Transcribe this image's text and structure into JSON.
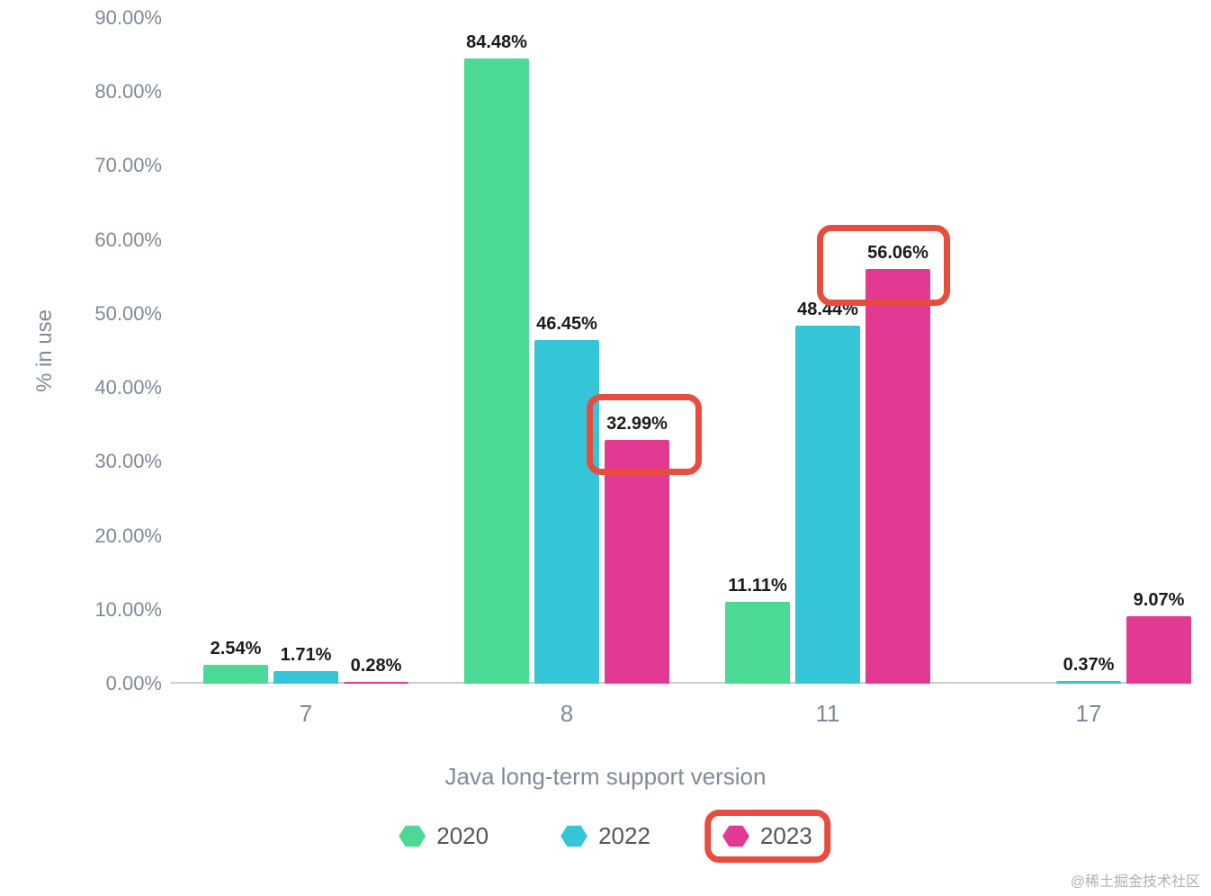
{
  "chart_data": {
    "type": "bar",
    "title": "",
    "xlabel": "Java long-term support version",
    "ylabel": "% in use",
    "ylim": [
      0,
      90
    ],
    "y_ticks": [
      "0.00%",
      "10.00%",
      "20.00%",
      "30.00%",
      "40.00%",
      "50.00%",
      "60.00%",
      "70.00%",
      "80.00%",
      "90.00%"
    ],
    "categories": [
      "7",
      "8",
      "11",
      "17"
    ],
    "series": [
      {
        "name": "2020",
        "color": "#4CD995",
        "values": [
          2.54,
          84.48,
          11.11,
          null
        ]
      },
      {
        "name": "2022",
        "color": "#34C5D9",
        "values": [
          1.71,
          46.45,
          48.44,
          0.37
        ]
      },
      {
        "name": "2023",
        "color": "#E23A93",
        "values": [
          0.28,
          32.99,
          56.06,
          9.07
        ]
      }
    ],
    "value_labels": [
      [
        "2.54%",
        "84.48%",
        "11.11%",
        null
      ],
      [
        "1.71%",
        "46.45%",
        "48.44%",
        "0.37%"
      ],
      [
        "0.28%",
        "32.99%",
        "56.06%",
        "9.07%"
      ]
    ],
    "legend_position": "bottom",
    "annotations": [
      {
        "target": "series-2023-category-8-value-label"
      },
      {
        "target": "series-2023-category-11-value-label"
      },
      {
        "target": "legend-2023"
      }
    ]
  },
  "watermark": "@稀土掘金技术社区"
}
